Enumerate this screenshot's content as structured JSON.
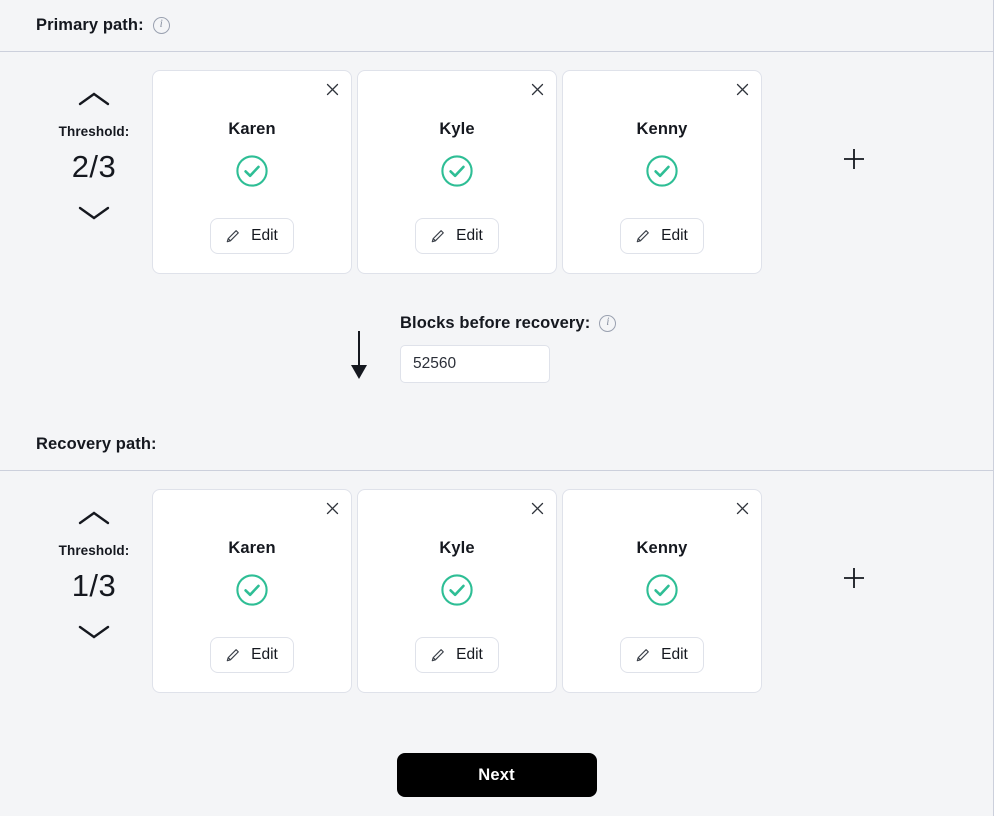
{
  "theme": {
    "background": "#f4f5f7",
    "card_background": "#ffffff",
    "border": "#dfe2ea",
    "divider": "#ccd0dc",
    "text": "#15181f",
    "accent_success": "#2ebe95",
    "button_primary_bg": "#000000",
    "button_primary_text": "#ffffff"
  },
  "primary_path": {
    "title": "Primary path:",
    "info_icon": "info-icon",
    "info_glyph": "i",
    "threshold": {
      "label": "Threshold:",
      "value": "2/3",
      "increase_icon": "chevron-up-icon",
      "decrease_icon": "chevron-down-icon"
    },
    "add_icon": "plus-icon",
    "cards": [
      {
        "name": "Karen",
        "status_icon": "check-circle-icon",
        "edit_label": "Edit",
        "edit_icon": "pencil-icon",
        "close_icon": "close-icon"
      },
      {
        "name": "Kyle",
        "status_icon": "check-circle-icon",
        "edit_label": "Edit",
        "edit_icon": "pencil-icon",
        "close_icon": "close-icon"
      },
      {
        "name": "Kenny",
        "status_icon": "check-circle-icon",
        "edit_label": "Edit",
        "edit_icon": "pencil-icon",
        "close_icon": "close-icon"
      }
    ]
  },
  "transition": {
    "arrow_icon": "arrow-down-icon",
    "blocks_label": "Blocks before recovery:",
    "info_icon": "info-icon",
    "info_glyph": "i",
    "blocks_value": "52560",
    "blocks_placeholder": "52560"
  },
  "recovery_path": {
    "title": "Recovery path:",
    "threshold": {
      "label": "Threshold:",
      "value": "1/3",
      "increase_icon": "chevron-up-icon",
      "decrease_icon": "chevron-down-icon"
    },
    "add_icon": "plus-icon",
    "cards": [
      {
        "name": "Karen",
        "status_icon": "check-circle-icon",
        "edit_label": "Edit",
        "edit_icon": "pencil-icon",
        "close_icon": "close-icon"
      },
      {
        "name": "Kyle",
        "status_icon": "check-circle-icon",
        "edit_label": "Edit",
        "edit_icon": "pencil-icon",
        "close_icon": "close-icon"
      },
      {
        "name": "Kenny",
        "status_icon": "check-circle-icon",
        "edit_label": "Edit",
        "edit_icon": "pencil-icon",
        "close_icon": "close-icon"
      }
    ]
  },
  "footer": {
    "next_label": "Next"
  }
}
